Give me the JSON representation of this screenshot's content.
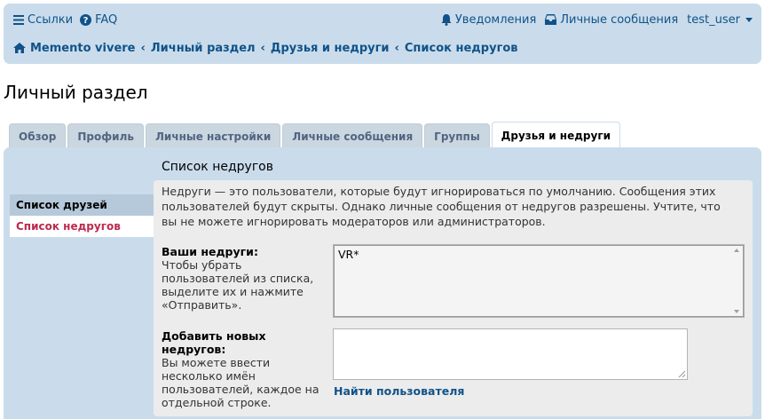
{
  "header": {
    "links_left": [
      {
        "label": "Ссылки",
        "icon": "bars-icon"
      },
      {
        "label": "FAQ",
        "icon": "question-circle-icon"
      }
    ],
    "links_right": [
      {
        "label": "Уведомления",
        "icon": "bell-icon"
      },
      {
        "label": "Личные сообщения",
        "icon": "inbox-icon"
      },
      {
        "label": "test_user",
        "icon": "chevron-down-icon"
      }
    ],
    "breadcrumbs": [
      "Memento vivere",
      "Личный раздел",
      "Друзья и недруги",
      "Список недругов"
    ],
    "breadcrumb_home_icon": "home-icon"
  },
  "page_title": "Личный раздел",
  "tabs": [
    {
      "label": "Обзор",
      "active": false
    },
    {
      "label": "Профиль",
      "active": false
    },
    {
      "label": "Личные настройки",
      "active": false
    },
    {
      "label": "Личные сообщения",
      "active": false
    },
    {
      "label": "Группы",
      "active": false
    },
    {
      "label": "Друзья и недруги",
      "active": true
    }
  ],
  "side_menu": [
    {
      "label": "Список друзей",
      "active": false
    },
    {
      "label": "Список недругов",
      "active": true
    }
  ],
  "section_title": "Список недругов",
  "intro_text": "Недруги — это пользователи, которые будут игнорироваться по умолчанию. Сообщения этих пользователей будут скрыты. Однако личные сообщения от недругов разрешены. Учтите, что вы не можете игнорировать модераторов или администраторов.",
  "foes_field": {
    "label": "Ваши недруги:",
    "help": "Чтобы убрать пользователей из списка, выделите их и нажмите «Отправить».",
    "options": [
      "VR*"
    ]
  },
  "add_field": {
    "label": "Добавить новых недругов:",
    "help": "Вы можете ввести несколько имён пользователей, каждое на отдельной строке.",
    "value": "",
    "find_link": "Найти пользователя"
  },
  "colors": {
    "header_bg": "#cadceb",
    "link": "#105289",
    "active_side": "#bc2a4d",
    "tab_bg": "#cad7e0",
    "content_bg": "#ececec"
  }
}
